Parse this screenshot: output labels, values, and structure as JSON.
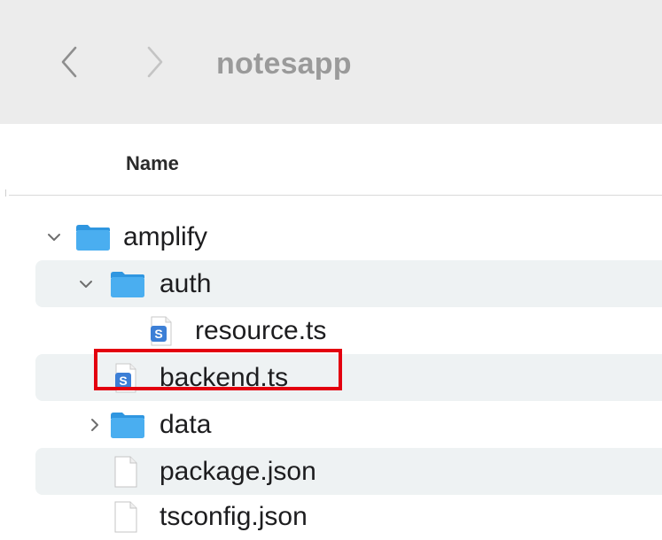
{
  "toolbar": {
    "title": "notesapp",
    "back_icon": "chevron-left-icon",
    "forward_icon": "chevron-right-icon"
  },
  "columns": {
    "name": "Name"
  },
  "files": [
    {
      "label": "amplify",
      "kind": "folder",
      "expanded": true,
      "depth": 0,
      "icon": "folder-icon"
    },
    {
      "label": "auth",
      "kind": "folder",
      "expanded": true,
      "depth": 1,
      "icon": "folder-icon"
    },
    {
      "label": "resource.ts",
      "kind": "typescript-file",
      "depth": 2,
      "icon": "typescript-file-icon"
    },
    {
      "label": "backend.ts",
      "kind": "typescript-file",
      "depth": 1,
      "icon": "typescript-file-icon",
      "highlighted": true
    },
    {
      "label": "data",
      "kind": "folder",
      "expanded": false,
      "depth": 1,
      "icon": "folder-icon"
    },
    {
      "label": "package.json",
      "kind": "file",
      "depth": 1,
      "icon": "document-icon"
    },
    {
      "label": "tsconfig.json",
      "kind": "file",
      "depth": 1,
      "icon": "document-icon"
    }
  ],
  "colors": {
    "folder": "#3ea3ea",
    "highlight_box": "#e3000f",
    "row_alt": "#eef2f3",
    "toolbar_bg": "#ececec"
  }
}
